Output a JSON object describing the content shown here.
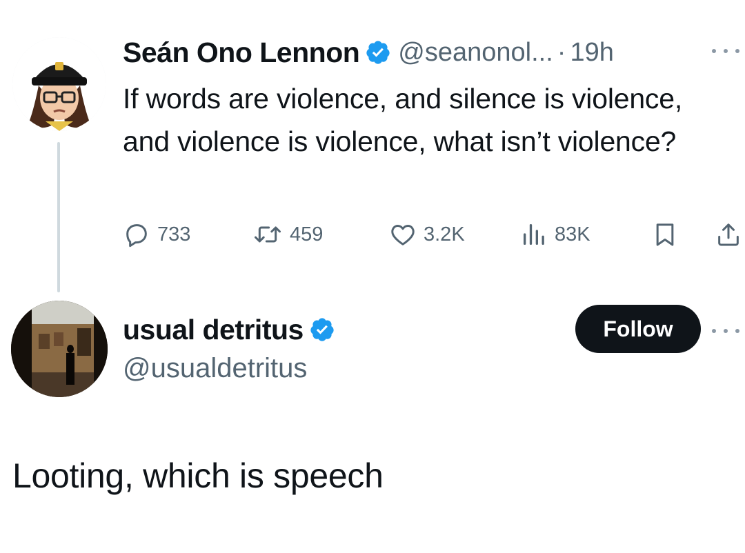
{
  "colors": {
    "verified": "#1d9bf0",
    "secondary_text": "#536471",
    "thread_line": "#cfd9de",
    "follow_button": "#0f1419"
  },
  "tweet": {
    "author_name": "Seán Ono Lennon",
    "author_handle": "@seanonol...",
    "separator": "·",
    "time": "19h",
    "text": "If words are violence, and silence is violence, and violence is violence, what isn’t violence?",
    "actions": {
      "replies": "733",
      "reposts": "459",
      "likes": "3.2K",
      "views": "83K"
    },
    "icons": [
      "reply-icon",
      "repost-icon",
      "like-icon",
      "views-icon",
      "bookmark-icon",
      "share-icon"
    ]
  },
  "reply": {
    "author_name": "usual detritus",
    "author_handle": "@usualdetritus",
    "follow_label": "Follow",
    "text": "Looting, which is speech"
  }
}
